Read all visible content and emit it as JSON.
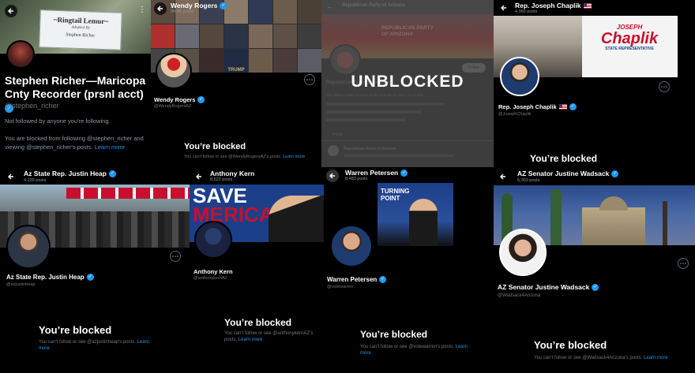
{
  "panels": {
    "richer": {
      "sign_line1": "~Ringtail Lemur~",
      "sign_line2": "Adopted By",
      "sign_line3": "Stephen Richer",
      "name": "Stephen Richer—Maricopa Cnty Recorder (prsnl acct)",
      "handle": "@stephen_richer",
      "followed_by": "Not followed by anyone you're following",
      "blocked_text": "You are blocked from following @stephen_richer and viewing @stephen_richer's posts. ",
      "learn_more": "Learn more"
    },
    "rogers": {
      "header_name": "Wendy Rogers",
      "posts": "34.4K posts",
      "name": "Wendy Rogers",
      "handle": "@WendyRogersAZ",
      "blocked_title": "You’re blocked",
      "blocked_text": "You can't follow or see @WendyRogersAZ's posts. ",
      "learn_more": "Learn more",
      "banner_text": "TRUMP"
    },
    "azgop": {
      "overlay": "UNBLOCKED",
      "header_name": "Republican Party of Arizona",
      "banner_text1": "REPUBLICAN PARTY",
      "banner_text2": "OF ARIZONA",
      "profile_name": "Republican Party of Arizona",
      "bio": "The official Twitter account of the Republican Party of Arizona.",
      "follow": "Follow",
      "posts_tab": "Posts",
      "post_author": "Republican Party of Arizona"
    },
    "chaplik": {
      "header_name": "Rep. Joseph Chaplik",
      "posts": "4,966 posts",
      "logo_top": "JOSEPH",
      "logo_main": "Chaplik",
      "logo_sub": "STATE REPRESENTATIVE",
      "name": "Rep. Joseph Chaplik",
      "handle": "@JosephChaplik",
      "blocked_title": "You’re blocked"
    },
    "heap": {
      "header_name": "Az State Rep. Justin Heap",
      "posts": "4,235 posts",
      "name": "Az State Rep. Justin Heap",
      "handle": "@azjustinheap",
      "blocked_title": "You’re blocked",
      "blocked_text": "You can't follow or see @azjustinheap's posts. ",
      "learn_more": "Learn more"
    },
    "kern": {
      "header_name": "Anthony Kern",
      "posts": "8,522 posts",
      "banner_text1": "SAVE",
      "banner_text2": "MERICA",
      "name": "Anthony Kern",
      "handle": "@anthonykernAZ",
      "blocked_title": "You’re blocked",
      "blocked_text": "You can't follow or see @anthonykernAZ's posts. ",
      "learn_more": "Learn more"
    },
    "petersen": {
      "header_name": "Warren Petersen",
      "posts": "8,483 posts",
      "banner_text": "TURNING POINT",
      "name": "Warren Petersen",
      "handle": "@votewarren",
      "blocked_title": "You’re blocked",
      "blocked_text": "You can't follow or see @votewarren's posts. ",
      "learn_more": "Learn more"
    },
    "wadsack": {
      "header_name": "AZ Senator Justine Wadsack",
      "posts": "6,303 posts",
      "name": "AZ Senator Justine Wadsack",
      "handle": "@Wadsack4Arizona",
      "blocked_title": "You’re blocked",
      "blocked_text": "You can't follow or see @Wadsack4Arizona's posts. ",
      "learn_more": "Learn more"
    }
  },
  "colors": {
    "background": "#000000",
    "verified": "#1d9bf0",
    "link": "#1d9bf0",
    "muted": "#71767b",
    "text": "#e7e9ea"
  }
}
